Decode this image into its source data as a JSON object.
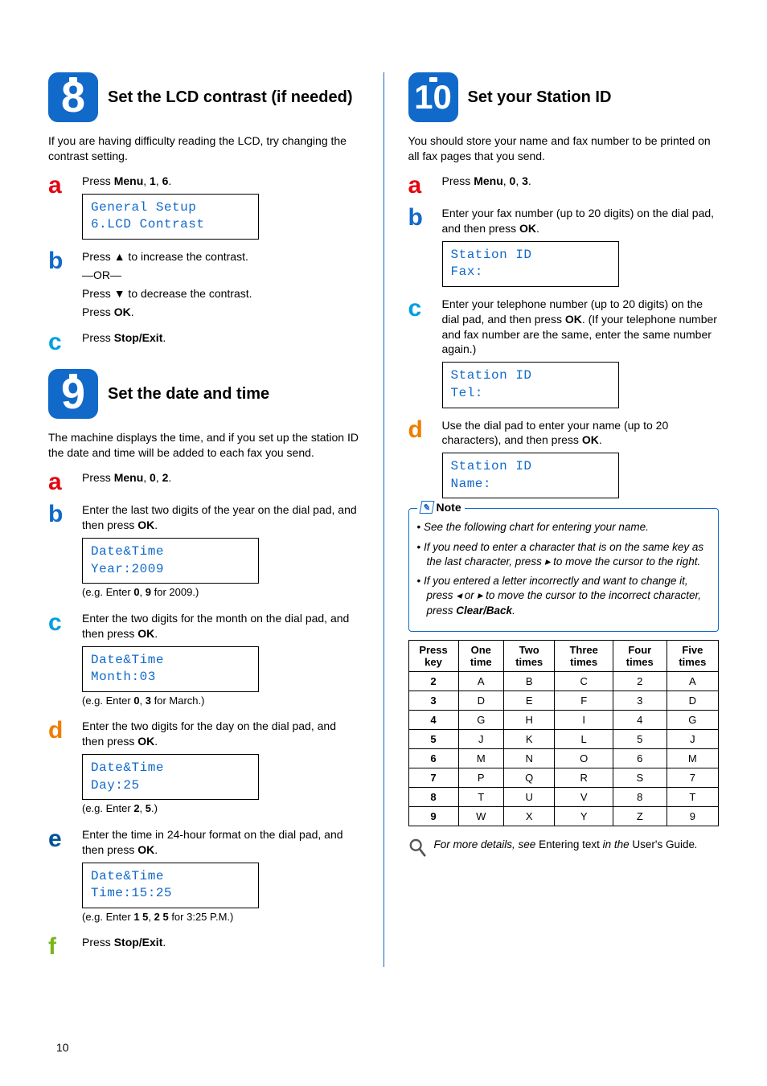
{
  "page_number": "10",
  "left": {
    "sec8": {
      "num": "8",
      "title": "Set the LCD contrast (if needed)",
      "intro": "If you are having difficulty reading the LCD, try changing the contrast setting.",
      "a": {
        "letter": "a",
        "pre": "Press ",
        "keys": "Menu",
        "mid": ", ",
        "k1": "1",
        "mid2": ", ",
        "k2": "6",
        "post": "."
      },
      "lcd_a_l1": "General Setup",
      "lcd_a_l2": "6.LCD Contrast",
      "b": {
        "letter": "b",
        "l1a": "Press ",
        "l1b": " to increase the contrast.",
        "or": "—OR—",
        "l2a": "Press ",
        "l2b": " to decrease the contrast.",
        "l3a": "Press ",
        "l3b": "OK",
        "l3c": "."
      },
      "c": {
        "letter": "c",
        "pre": "Press ",
        "key": "Stop/Exit",
        "post": "."
      }
    },
    "sec9": {
      "num": "9",
      "title": "Set the date and time",
      "intro": "The machine displays the time, and if you set up the station ID the date and time will be added to each fax you send.",
      "a": {
        "letter": "a",
        "pre": "Press ",
        "keys": "Menu",
        "mid": ", ",
        "k1": "0",
        "mid2": ", ",
        "k2": "2",
        "post": "."
      },
      "b": {
        "letter": "b",
        "pre": "Enter the last two digits of the year on the dial pad, and then press ",
        "key": "OK",
        "post": "."
      },
      "lcd_b_l1": "Date&Time",
      "lcd_b_l2": "Year:2009",
      "b_eg_pre": "(e.g. Enter ",
      "b_eg_k1": "0",
      "b_eg_mid": ", ",
      "b_eg_k2": "9",
      "b_eg_post": " for 2009.)",
      "c": {
        "letter": "c",
        "pre": "Enter the two digits for the month on the dial pad, and then press ",
        "key": "OK",
        "post": "."
      },
      "lcd_c_l1": "Date&Time",
      "lcd_c_l2": "Month:03",
      "c_eg_pre": "(e.g. Enter ",
      "c_eg_k1": "0",
      "c_eg_mid": ", ",
      "c_eg_k2": "3",
      "c_eg_post": " for March.)",
      "d": {
        "letter": "d",
        "pre": "Enter the two digits for the day on the dial pad, and then press ",
        "key": "OK",
        "post": "."
      },
      "lcd_d_l1": "Date&Time",
      "lcd_d_l2": "Day:25",
      "d_eg_pre": "(e.g. Enter ",
      "d_eg_k1": "2",
      "d_eg_mid": ", ",
      "d_eg_k2": "5",
      "d_eg_post": ".)",
      "e": {
        "letter": "e",
        "pre": "Enter the time in 24-hour format on the dial pad, and then press ",
        "key": "OK",
        "post": "."
      },
      "lcd_e_l1": "Date&Time",
      "lcd_e_l2": "Time:15:25",
      "e_eg_pre": "(e.g. Enter ",
      "e_eg_k1": "1 5",
      "e_eg_mid": ", ",
      "e_eg_k2": "2 5",
      "e_eg_post": " for 3:25 P.M.)",
      "f": {
        "letter": "f",
        "pre": "Press ",
        "key": "Stop/Exit",
        "post": "."
      }
    }
  },
  "right": {
    "sec10": {
      "num": "10",
      "title": "Set your Station ID",
      "intro": "You should store your name and fax number to be printed on all fax pages that you send.",
      "a": {
        "letter": "a",
        "pre": "Press ",
        "keys": "Menu",
        "mid": ", ",
        "k1": "0",
        "mid2": ", ",
        "k2": "3",
        "post": "."
      },
      "b": {
        "letter": "b",
        "pre": "Enter your fax number (up to 20 digits) on the dial pad, and then press ",
        "key": "OK",
        "post": "."
      },
      "lcd_b_l1": "Station ID",
      "lcd_b_l2": "Fax:",
      "c": {
        "letter": "c",
        "pre": "Enter your telephone number (up to 20 digits) on the dial pad, and then press ",
        "key": "OK",
        "post": ". (If your telephone number and fax number are the same, enter the same number again.)"
      },
      "lcd_c_l1": "Station ID",
      "lcd_c_l2": "Tel:",
      "d": {
        "letter": "d",
        "pre": "Use the dial pad to enter your name (up to 20 characters), and then press ",
        "key": "OK",
        "post": "."
      },
      "lcd_d_l1": "Station ID",
      "lcd_d_l2": "Name:",
      "note_label": "Note",
      "note1": "See the following chart for entering your name.",
      "note2_a": "If you need to enter a character that is on the same key as the last character, press ",
      "note2_b": " to move the cursor to the right.",
      "note3_a": "If you entered a letter incorrectly and want to change it, press ",
      "note3_b": " or ",
      "note3_c": " to move the cursor to the incorrect character, press ",
      "note3_key": "Clear/Back",
      "note3_d": ".",
      "table": {
        "headers": [
          "Press key",
          "One time",
          "Two times",
          "Three times",
          "Four times",
          "Five times"
        ],
        "rows": [
          [
            "2",
            "A",
            "B",
            "C",
            "2",
            "A"
          ],
          [
            "3",
            "D",
            "E",
            "F",
            "3",
            "D"
          ],
          [
            "4",
            "G",
            "H",
            "I",
            "4",
            "G"
          ],
          [
            "5",
            "J",
            "K",
            "L",
            "5",
            "J"
          ],
          [
            "6",
            "M",
            "N",
            "O",
            "6",
            "M"
          ],
          [
            "7",
            "P",
            "Q",
            "R",
            "S",
            "7"
          ],
          [
            "8",
            "T",
            "U",
            "V",
            "8",
            "T"
          ],
          [
            "9",
            "W",
            "X",
            "Y",
            "Z",
            "9"
          ]
        ]
      },
      "tip_a": "For more details, see ",
      "tip_b": "Entering text",
      "tip_c": " in the ",
      "tip_d": "User's Guide",
      "tip_e": "."
    }
  }
}
